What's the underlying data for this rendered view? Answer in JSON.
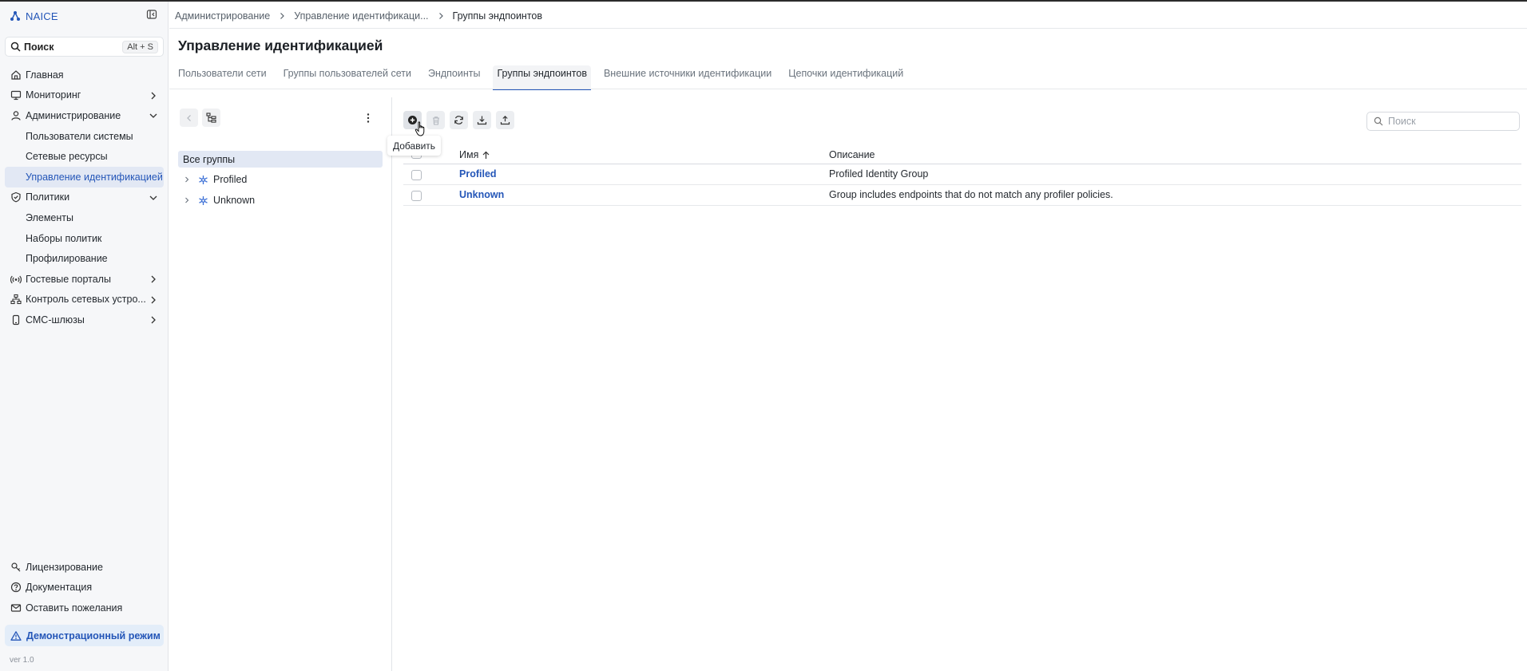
{
  "app": {
    "name": "NAICE",
    "version": "ver 1.0"
  },
  "search": {
    "label": "Поиск",
    "shortcut": "Alt + S"
  },
  "sidebar": {
    "items": [
      {
        "label": "Главная",
        "icon": "home-icon"
      },
      {
        "label": "Мониторинг",
        "icon": "monitor-icon"
      },
      {
        "label": "Администрирование",
        "icon": "user-icon"
      },
      {
        "label": "Пользователи системы"
      },
      {
        "label": "Сетевые ресурсы"
      },
      {
        "label": "Управление идентификацией"
      },
      {
        "label": "Политики",
        "icon": "shield-check-icon"
      },
      {
        "label": "Элементы"
      },
      {
        "label": "Наборы политик"
      },
      {
        "label": "Профилирование"
      },
      {
        "label": "Гостевые порталы",
        "icon": "radio-waves-icon"
      },
      {
        "label": "Контроль сетевых устро...",
        "icon": "network-icon"
      },
      {
        "label": "СМС-шлюзы",
        "icon": "phone-icon"
      }
    ],
    "bottom": [
      {
        "label": "Лицензирование",
        "icon": "license-icon"
      },
      {
        "label": "Документация",
        "icon": "help-icon"
      },
      {
        "label": "Оставить пожелания",
        "icon": "mail-icon"
      }
    ],
    "demo_mode": "Демонстрационный режим"
  },
  "breadcrumb": [
    "Администрирование",
    "Управление идентификаци...",
    "Группы эндпоинтов"
  ],
  "page": {
    "title": "Управление идентификацией",
    "tabs": [
      "Пользователи сети",
      "Группы пользователей сети",
      "Эндпоинты",
      "Группы эндпоинтов",
      "Внешние источники идентификации",
      "Цепочки идентификаций"
    ],
    "active_tab": "Группы эндпоинтов"
  },
  "tree": {
    "all_label": "Все группы",
    "nodes": [
      "Profiled",
      "Unknown"
    ]
  },
  "toolbar": {
    "add_tooltip": "Добавить"
  },
  "table": {
    "search_placeholder": "Поиск",
    "columns": [
      "Имя",
      "Описание"
    ],
    "rows": [
      {
        "name": "Profiled",
        "description": "Profiled Identity Group"
      },
      {
        "name": "Unknown",
        "description": "Group includes endpoints that do not match any profiler policies."
      }
    ]
  },
  "colors": {
    "accent": "#2456b8",
    "sidebar_bg": "#f6f7f9",
    "active_bg": "#e2e8f4"
  }
}
